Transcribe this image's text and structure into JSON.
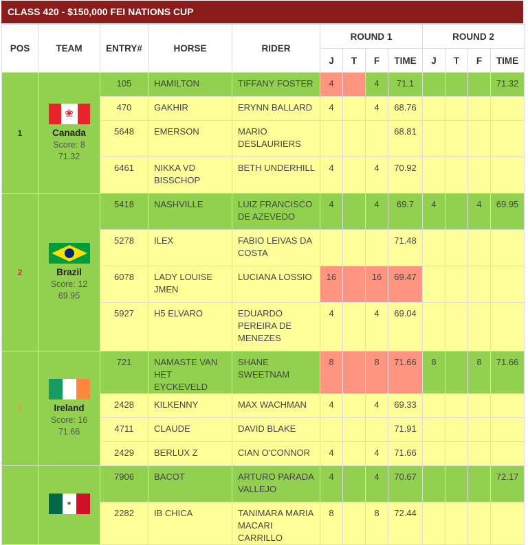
{
  "title": "CLASS 420 - $150,000 FEI NATIONS CUP",
  "headers": {
    "pos": "POS",
    "team": "TEAM",
    "entry": "ENTRY#",
    "horse": "HORSE",
    "rider": "RIDER",
    "round1": "ROUND 1",
    "round2": "ROUND 2",
    "j": "J",
    "t": "T",
    "f": "F",
    "time": "TIME"
  },
  "colors": {
    "title_bg": "#8a1c1c",
    "green": "#92d050",
    "yellow": "#ffff99",
    "fault_red": "#ff9480"
  },
  "teams": [
    {
      "pos": "1",
      "pos_color": "#1f3f1f",
      "name": "Canada",
      "score": "Score: 8",
      "time": "71.32",
      "flag_icon": "canada-flag-icon",
      "rows": [
        {
          "entry": "105",
          "horse": "HAMILTON",
          "rider": "TIFFANY FOSTER",
          "r1j": "4",
          "r1t": "",
          "r1f": "4",
          "r1time": "71.1",
          "r2j": "",
          "r2t": "",
          "r2f": "",
          "r2time": "71.32",
          "green": true,
          "red_j": true,
          "red_t": true
        },
        {
          "entry": "470",
          "horse": "GAKHIR",
          "rider": "ERYNN BALLARD",
          "r1j": "4",
          "r1t": "",
          "r1f": "4",
          "r1time": "68.76",
          "r2j": "",
          "r2t": "",
          "r2f": "",
          "r2time": "",
          "green": false
        },
        {
          "entry": "5648",
          "horse": "EMERSON",
          "rider": "MARIO DESLAURIERS",
          "r1j": "",
          "r1t": "",
          "r1f": "",
          "r1time": "68.81",
          "r2j": "",
          "r2t": "",
          "r2f": "",
          "r2time": "",
          "green": false
        },
        {
          "entry": "6461",
          "horse": "NIKKA VD BISSCHOP",
          "rider": "BETH UNDERHILL",
          "r1j": "4",
          "r1t": "",
          "r1f": "4",
          "r1time": "70.92",
          "r2j": "",
          "r2t": "",
          "r2f": "",
          "r2time": "",
          "green": false
        }
      ]
    },
    {
      "pos": "2",
      "pos_color": "#c0392b",
      "name": "Brazil",
      "score": "Score: 12",
      "time": "69.95",
      "flag_icon": "brazil-flag-icon",
      "rows": [
        {
          "entry": "5418",
          "horse": "NASHVILLE",
          "rider": "LUIZ FRANCISCO DE AZEVEDO",
          "r1j": "4",
          "r1t": "",
          "r1f": "4",
          "r1time": "69.7",
          "r2j": "4",
          "r2t": "",
          "r2f": "4",
          "r2time": "69.95",
          "green": true
        },
        {
          "entry": "5278",
          "horse": "ILEX",
          "rider": "FABIO LEIVAS DA COSTA",
          "r1j": "",
          "r1t": "",
          "r1f": "",
          "r1time": "71.48",
          "r2j": "",
          "r2t": "",
          "r2f": "",
          "r2time": "",
          "green": false
        },
        {
          "entry": "6078",
          "horse": "LADY LOUISE JMEN",
          "rider": "LUCIANA LOSSIO",
          "r1j": "16",
          "r1t": "",
          "r1f": "16",
          "r1time": "69.47",
          "r2j": "",
          "r2t": "",
          "r2f": "",
          "r2time": "",
          "green": false,
          "red_all": true
        },
        {
          "entry": "5927",
          "horse": "H5 ELVARO",
          "rider": "EDUARDO PEREIRA DE MENEZES",
          "r1j": "4",
          "r1t": "",
          "r1f": "4",
          "r1time": "69.04",
          "r2j": "",
          "r2t": "",
          "r2f": "",
          "r2time": "",
          "green": false
        }
      ]
    },
    {
      "pos": "3",
      "pos_color": "#e3a020",
      "name": "Ireland",
      "score": "Score: 16",
      "time": "71.66",
      "flag_icon": "ireland-flag-icon",
      "rows": [
        {
          "entry": "721",
          "horse": "NAMASTE VAN HET EYCKEVELD",
          "rider": "SHANE SWEETNAM",
          "r1j": "8",
          "r1t": "",
          "r1f": "8",
          "r1time": "71.66",
          "r2j": "8",
          "r2t": "",
          "r2f": "8",
          "r2time": "71.66",
          "green": true,
          "red_all": true
        },
        {
          "entry": "2428",
          "horse": "KILKENNY",
          "rider": "MAX WACHMAN",
          "r1j": "4",
          "r1t": "",
          "r1f": "4",
          "r1time": "69.33",
          "r2j": "",
          "r2t": "",
          "r2f": "",
          "r2time": "",
          "green": false
        },
        {
          "entry": "4711",
          "horse": "CLAUDE",
          "rider": "DAVID BLAKE",
          "r1j": "",
          "r1t": "",
          "r1f": "",
          "r1time": "71.91",
          "r2j": "",
          "r2t": "",
          "r2f": "",
          "r2time": "",
          "green": false
        },
        {
          "entry": "2429",
          "horse": "BERLUX Z",
          "rider": "CIAN O'CONNOR",
          "r1j": "4",
          "r1t": "",
          "r1f": "4",
          "r1time": "71.66",
          "r2j": "",
          "r2t": "",
          "r2f": "",
          "r2time": "",
          "green": false
        }
      ]
    },
    {
      "pos": "",
      "pos_color": "#333",
      "name": "",
      "score": "",
      "time": "",
      "flag_icon": "mexico-flag-icon",
      "rows": [
        {
          "entry": "7906",
          "horse": "BACOT",
          "rider": "ARTURO PARADA VALLEJO",
          "r1j": "4",
          "r1t": "",
          "r1f": "4",
          "r1time": "70.67",
          "r2j": "",
          "r2t": "",
          "r2f": "",
          "r2time": "72.17",
          "green": true
        },
        {
          "entry": "2282",
          "horse": "IB CHICA",
          "rider": "TANIMARA MARIA MACARI CARRILLO",
          "r1j": "8",
          "r1t": "",
          "r1f": "8",
          "r1time": "72.44",
          "r2j": "",
          "r2t": "",
          "r2f": "",
          "r2time": "",
          "green": false
        }
      ]
    }
  ]
}
